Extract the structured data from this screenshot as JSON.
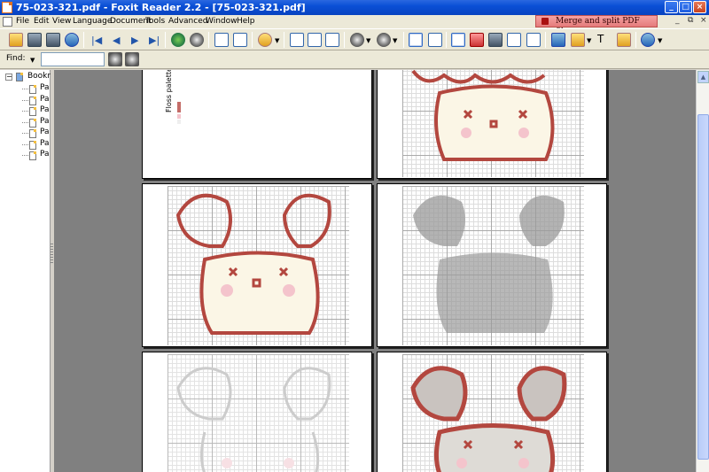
{
  "window": {
    "title": "75-023-321.pdf - Foxit Reader 2.2 - [75-023-321.pdf]",
    "buttons": {
      "minimize": "_",
      "maximize": "□",
      "close": "×"
    }
  },
  "menu": {
    "items": [
      "File",
      "Edit",
      "View",
      "Language",
      "Document",
      "Tools",
      "Advanced",
      "Window",
      "Help"
    ],
    "ad_text": "Merge and split PDF files",
    "mdi_min": "_",
    "mdi_restore": "⧉",
    "mdi_close": "×"
  },
  "toolbar": {
    "icons": [
      "open-icon",
      "save-icon",
      "print-icon",
      "email-icon",
      "first-page-icon",
      "prev-page-icon",
      "next-page-icon",
      "last-page-icon",
      "go-back-icon",
      "go-forward-icon",
      "rotate-left-icon",
      "rotate-right-icon",
      "zoom-tool-icon",
      "actual-size-icon",
      "fit-page-icon",
      "fit-width-icon",
      "zoom-out-icon",
      "zoom-in-icon",
      "continuous-view-icon",
      "facing-view-icon",
      "hand-tool-icon",
      "snapshot-icon",
      "find-icon",
      "select-text-icon",
      "select-image-icon",
      "comment-tool-icon",
      "highlight-icon",
      "typewriter-icon",
      "note-icon",
      "info-icon"
    ],
    "nav_glyphs": {
      "first": "|◀",
      "prev": "◀",
      "next": "▶",
      "last": "▶|"
    }
  },
  "findbar": {
    "label": "Find:",
    "value": "",
    "placeholder": ""
  },
  "navpanel": {
    "root_label": "Bookn",
    "items": [
      "Pa",
      "Pa",
      "Pa",
      "Pa",
      "Pa",
      "Pa",
      "Pa"
    ]
  },
  "document": {
    "legend_title": "Floss palette",
    "colors": {
      "stitch_red": "#b3473f",
      "stitch_pink": "#f4c4cc",
      "face_fill": "#fbf6e6",
      "gray_pattern": "#8c8c8c",
      "page_bg": "#808080"
    }
  },
  "scrollbar": {
    "up_arrow": "▲"
  }
}
